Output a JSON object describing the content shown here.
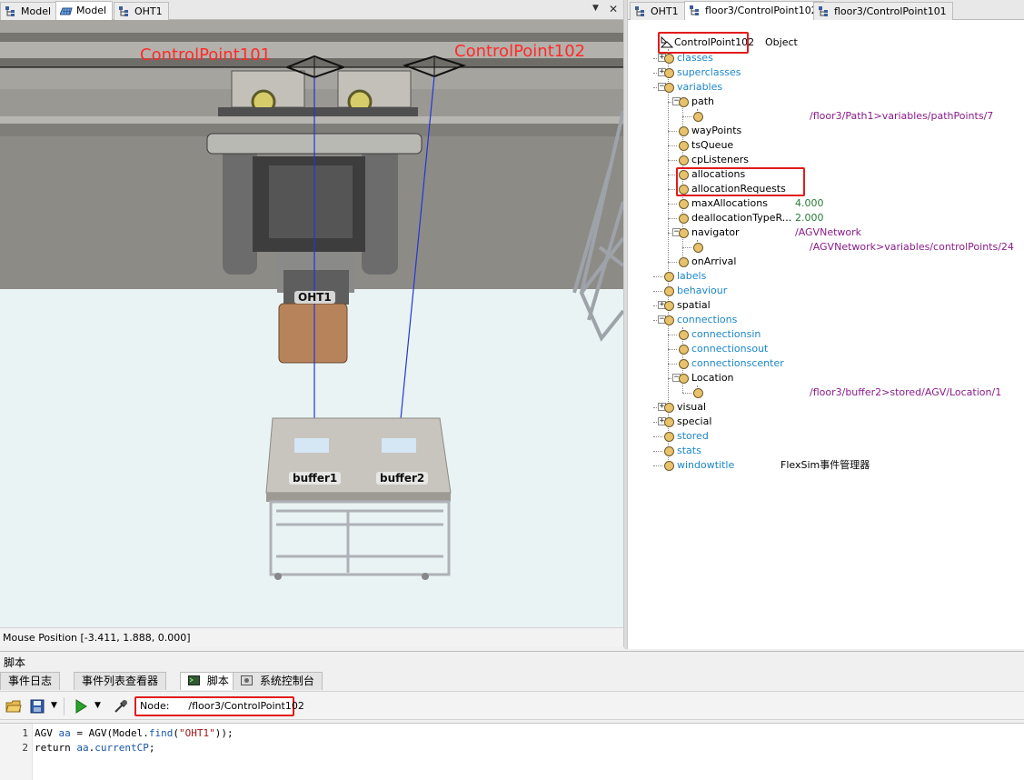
{
  "left_panel": {
    "tabs": [
      {
        "label": "Model",
        "icon": "tree-icon"
      },
      {
        "label": "Model",
        "icon": "grid-3d-icon"
      },
      {
        "label": "OHT1",
        "icon": "tree-icon"
      }
    ],
    "viewport_labels": {
      "control_point_1": "ControlPoint101",
      "control_point_2": "ControlPoint102",
      "oht": "OHT1",
      "buffer1": "buffer1",
      "buffer2": "buffer2"
    },
    "status": "Mouse Position [-3.411, 1.888, 0.000]"
  },
  "right_panel": {
    "tabs": [
      {
        "label": "OHT1"
      },
      {
        "label": "floor3/ControlPoint102"
      },
      {
        "label": "floor3/ControlPoint101"
      }
    ],
    "root": {
      "label": "ControlPoint102",
      "type": "Object"
    },
    "tree": [
      {
        "label": "classes",
        "depth": 0
      },
      {
        "label": "superclasses",
        "depth": 0
      },
      {
        "label": "variables",
        "depth": 0
      },
      {
        "label": "path",
        "depth": 1
      },
      {
        "label": "",
        "value": "/floor3/Path1>variables/pathPoints/7",
        "depth": 2
      },
      {
        "label": "wayPoints",
        "depth": 1
      },
      {
        "label": "tsQueue",
        "depth": 1
      },
      {
        "label": "cpListeners",
        "depth": 1
      },
      {
        "label": "allocations",
        "depth": 1
      },
      {
        "label": "allocationRequests",
        "depth": 1
      },
      {
        "label": "maxAllocations",
        "value": "4.000",
        "depth": 1
      },
      {
        "label": "deallocationTypeR...",
        "value": "2.000",
        "depth": 1
      },
      {
        "label": "navigator",
        "value": "/AGVNetwork",
        "depth": 1
      },
      {
        "label": "",
        "value": "/AGVNetwork>variables/controlPoints/24",
        "depth": 2
      },
      {
        "label": "onArrival",
        "depth": 1
      },
      {
        "label": "labels",
        "depth": 0
      },
      {
        "label": "behaviour",
        "depth": 0
      },
      {
        "label": "spatial",
        "depth": 0
      },
      {
        "label": "connections",
        "depth": 0
      },
      {
        "label": "connectionsin",
        "depth": 1
      },
      {
        "label": "connectionsout",
        "depth": 1
      },
      {
        "label": "connectionscenter",
        "depth": 1
      },
      {
        "label": "Location",
        "depth": 1
      },
      {
        "label": "",
        "value": "/floor3/buffer2>stored/AGV/Location/1",
        "depth": 2
      },
      {
        "label": "visual",
        "depth": 0
      },
      {
        "label": "special",
        "depth": 0
      },
      {
        "label": "stored",
        "depth": 0
      },
      {
        "label": "stats",
        "depth": 0
      },
      {
        "label": "windowtitle",
        "value": "FlexSim事件管理器",
        "depth": 0
      }
    ]
  },
  "bottom_panel": {
    "title": "脚本",
    "tabs": [
      {
        "label": "事件日志"
      },
      {
        "label": "事件列表查看器"
      },
      {
        "label": "脚本"
      },
      {
        "label": "系统控制台"
      }
    ],
    "node_label": "Node:",
    "node_path": "/floor3/ControlPoint102",
    "code_lines": [
      {
        "num": "1",
        "text": "AGV aa = AGV(Model.find(\"OHT1\"));"
      },
      {
        "num": "2",
        "text": "return aa.currentCP;"
      }
    ]
  },
  "colors": {
    "highlight_red": "#e21b1b",
    "link_blue": "#1c86c8",
    "value_purple": "#8a1b8a",
    "value_green": "#2a7a3a",
    "control_point_label_red": "#ff2a2a"
  }
}
